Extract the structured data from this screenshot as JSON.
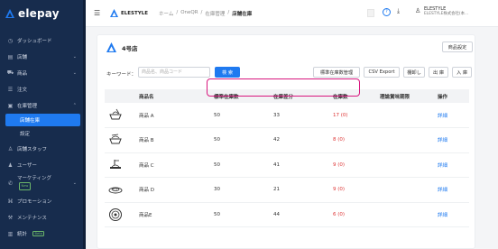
{
  "app": {
    "name": "elepay"
  },
  "sidebar": {
    "items": [
      {
        "label": "ダッシュボード",
        "icon": "clock-icon"
      },
      {
        "label": "店舗",
        "icon": "store-icon",
        "chevron": true
      },
      {
        "label": "商品",
        "icon": "cart-icon",
        "chevron": true
      },
      {
        "label": "注文",
        "icon": "receipt-icon"
      },
      {
        "label": "在庫管理",
        "icon": "box-icon",
        "chevron": true,
        "expanded": true
      },
      {
        "label": "店舗在庫",
        "active": true
      },
      {
        "label": "設定",
        "sub": true
      },
      {
        "label": "店舗スタッフ",
        "icon": "staff-icon"
      },
      {
        "label": "ユーザー",
        "icon": "user-icon"
      },
      {
        "label": "マーケティング",
        "icon": "megaphone-icon",
        "chevron": true,
        "badge": "New"
      },
      {
        "label": "プロモーション",
        "icon": "promo-icon"
      },
      {
        "label": "メンテナンス",
        "icon": "wrench-icon"
      },
      {
        "label": "統計",
        "icon": "chart-icon",
        "badge": "Beta"
      }
    ]
  },
  "header": {
    "brand": "ELESTYLE",
    "breadcrumb": [
      "ホーム",
      "/",
      "OneQR",
      "/",
      "在庫管理",
      "/",
      "店舗在庫"
    ],
    "user": {
      "name": "ELESTYLE",
      "org": "ELESTYLE株式会社(本..."
    }
  },
  "store": {
    "name": "4号店",
    "settings_label": "商品設定"
  },
  "filter": {
    "keyword_label": "キーワード：",
    "placeholder": "商品名、商品コード",
    "search_label": "検 索"
  },
  "actions": {
    "std_stock": "標準在庫数管理",
    "csv": "CSV Export",
    "stocktake": "棚卸し",
    "out": "出 庫",
    "in": "入 庫"
  },
  "table": {
    "headers": [
      "",
      "商品名",
      "標準在庫数",
      "在庫差分",
      "在庫数",
      "理論賞味期限",
      "操作"
    ],
    "rows": [
      {
        "name": "商品 A",
        "std": "50",
        "diff": "33",
        "stock": "17",
        "paren": "(0)",
        "action": "詳細"
      },
      {
        "name": "商品 B",
        "std": "50",
        "diff": "42",
        "stock": "8",
        "paren": "(0)",
        "action": "詳細"
      },
      {
        "name": "商品 C",
        "std": "50",
        "diff": "41",
        "stock": "9",
        "paren": "(0)",
        "action": "詳細"
      },
      {
        "name": "商品 D",
        "std": "30",
        "diff": "21",
        "stock": "9",
        "paren": "(0)",
        "action": "詳細"
      },
      {
        "name": "商品E",
        "std": "50",
        "diff": "44",
        "stock": "6",
        "paren": "(0)",
        "action": "詳細"
      }
    ]
  },
  "colors": {
    "sidebar": "#172c4d",
    "accent": "#1f7af0",
    "highlight": "#d8167e",
    "alert": "#d33333"
  }
}
